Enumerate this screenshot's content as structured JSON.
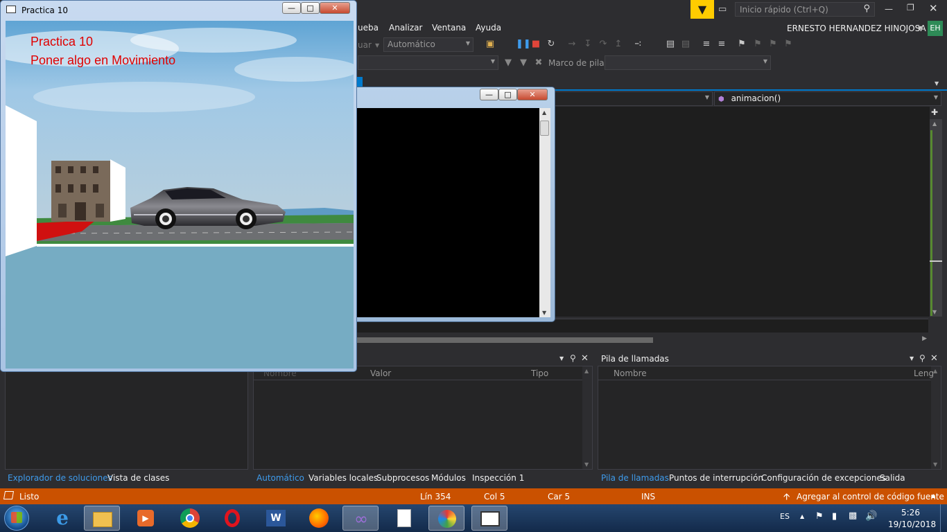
{
  "vs": {
    "quick_launch_placeholder": "Inicio rápido (Ctrl+Q)",
    "user_name": "ERNESTO HERNANDEZ HINOJOSA",
    "user_initials": "EH",
    "menu": [
      "ueba",
      "Analizar",
      "Ventana",
      "Ayuda"
    ],
    "toolbar": {
      "config_partial": "uar",
      "config_value": "Automático",
      "stack_frame_label": "Marco de pila:"
    },
    "editor": {
      "member_dropdown": "animacion()"
    },
    "autos_panel": {
      "columns": [
        "Nombre",
        "Valor",
        "Tipo"
      ],
      "tabs": [
        "Automático",
        "Variables locales",
        "Subprocesos",
        "Módulos",
        "Inspección 1"
      ]
    },
    "left_panel": {
      "tabs": [
        "Explorador de soluciones",
        "Vista de clases"
      ]
    },
    "callstack_panel": {
      "title": "Pila de llamadas",
      "columns": [
        "Nombre",
        "Leng"
      ],
      "tabs": [
        "Pila de llamadas",
        "Puntos de interrupción",
        "Configuración de excepciones",
        "Salida"
      ]
    },
    "status": {
      "ready": "Listo",
      "line": "Lín 354",
      "col": "Col 5",
      "car": "Car 5",
      "ins": "INS",
      "source_control": "Agregar al control de código fuente"
    }
  },
  "gl_window": {
    "title": "Practica 10",
    "overlay_line1": "Practica 10",
    "overlay_line2": "Poner algo en Movimiento"
  },
  "taskbar": {
    "lang": "ES",
    "time": "5:26",
    "date": "19/10/2018"
  },
  "colors": {
    "accent": "#007acc",
    "status_bar": "#ca5100",
    "vs_bg": "#2d2d30",
    "overlay_text": "#e00000"
  }
}
